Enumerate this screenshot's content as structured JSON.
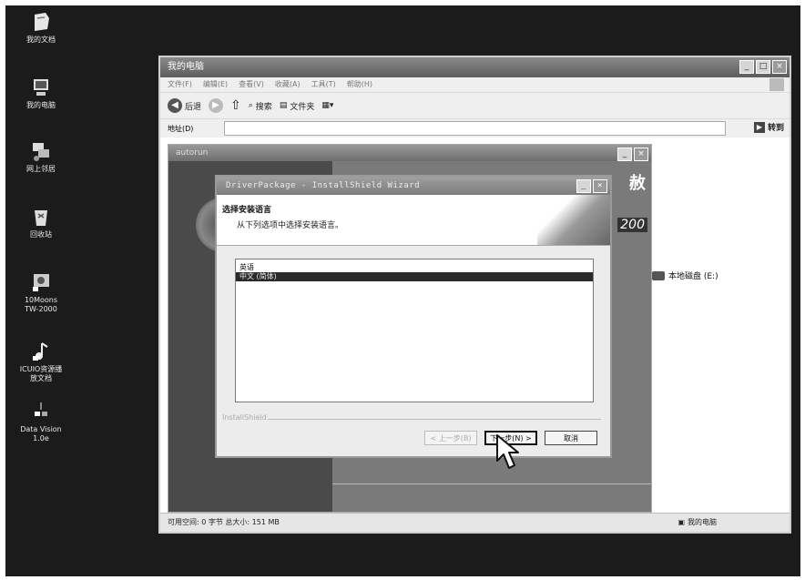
{
  "desktop": {
    "icons": [
      {
        "label": "我的文档",
        "icon": "documents-icon"
      },
      {
        "label": "我的电脑",
        "icon": "computer-icon"
      },
      {
        "label": "网上邻居",
        "icon": "network-icon"
      },
      {
        "label": "回收站",
        "icon": "recycle-bin-icon"
      },
      {
        "label": "10Moons\nTW-2000",
        "icon": "tv-card-icon"
      },
      {
        "label": "ICUIO资源播\n放文档",
        "icon": "media-icon"
      },
      {
        "label": "Data Vision\n1.0e",
        "icon": "app-icon"
      }
    ]
  },
  "explorer": {
    "title": "我的电脑",
    "menu": [
      "文件(F)",
      "编辑(E)",
      "查看(V)",
      "收藏(A)",
      "工具(T)",
      "帮助(H)"
    ],
    "toolbar": {
      "back_label": "后退",
      "search_label": "搜索",
      "folders_label": "文件夹"
    },
    "address_label": "地址(D)",
    "go_label": "转到",
    "drive_label": "本地磁盘 (E:)",
    "status": {
      "left": "可用空间: 0 字节 总大小: 151 MB",
      "right": "我的电脑"
    }
  },
  "autorun": {
    "title": "autorun",
    "brand": "赦",
    "model": "200"
  },
  "wizard": {
    "title": "DriverPackage - InstallShield Wizard",
    "heading": "选择安装语言",
    "subheading": "从下列选项中选择安装语言。",
    "languages": [
      "英语",
      "中文 (简体)"
    ],
    "selected_index": 1,
    "brand_footer": "InstallShield",
    "buttons": {
      "back": "< 上一步(B)",
      "next": "下一步(N) >",
      "cancel": "取消"
    }
  }
}
